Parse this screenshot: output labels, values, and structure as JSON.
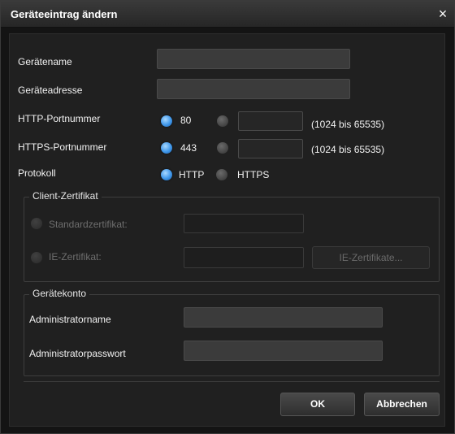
{
  "dialog": {
    "title": "Geräteeintrag ändern",
    "close_glyph": "×"
  },
  "fields": {
    "device_name": {
      "label": "Gerätename",
      "value": ""
    },
    "device_address": {
      "label": "Geräteadresse",
      "value": ""
    },
    "http_port": {
      "label": "HTTP-Portnummer",
      "default_option": "80",
      "custom_value": "",
      "range_hint": "(1024 bis 65535)",
      "selected": "default"
    },
    "https_port": {
      "label": "HTTPS-Portnummer",
      "default_option": "443",
      "custom_value": "",
      "range_hint": "(1024 bis 65535)",
      "selected": "default"
    },
    "protocol": {
      "label": "Protokoll",
      "option_http": "HTTP",
      "option_https": "HTTPS",
      "selected": "HTTP"
    }
  },
  "client_certificate": {
    "legend": "Client-Zertifikat",
    "standard_label": "Standardzertifikat:",
    "ie_label": "IE-Zertifikat:",
    "ie_button": "IE-Zertifikate...",
    "enabled": false
  },
  "device_account": {
    "legend": "Gerätekonto",
    "admin_name_label": "Administratorname",
    "admin_password_label": "Administratorpasswort",
    "admin_name_value": "",
    "admin_password_value": ""
  },
  "buttons": {
    "ok": "OK",
    "cancel": "Abbrechen"
  },
  "colors": {
    "background": "#141414",
    "panel": "#202020",
    "radio_selected": "#3f97ea",
    "text": "#f2f2f2",
    "disabled_text": "#6e6e6e"
  }
}
